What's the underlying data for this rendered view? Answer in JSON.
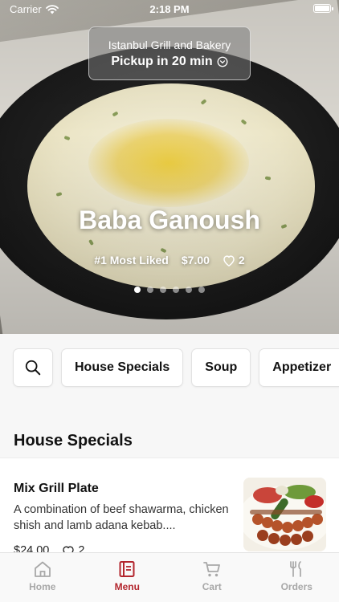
{
  "status_bar": {
    "carrier": "Carrier",
    "time": "2:18 PM"
  },
  "restaurant": {
    "name": "Istanbul Grill and Bakery",
    "pickup": "Pickup in 20 min"
  },
  "featured": {
    "title": "Baba Ganoush",
    "badge": "#1 Most Liked",
    "price": "$7.00",
    "likes": "2",
    "slide_count": 6,
    "active_slide": 1
  },
  "categories": [
    {
      "label": "House Specials"
    },
    {
      "label": "Soup"
    },
    {
      "label": "Appetizer"
    }
  ],
  "section": {
    "title": "House Specials"
  },
  "items": [
    {
      "name": "Mix Grill Plate",
      "description": "A combination of beef shawarma, chicken shish and lamb adana kebab....",
      "price": "$24.00",
      "likes": "2"
    }
  ],
  "tabs": [
    {
      "label": "Home",
      "icon": "home-icon"
    },
    {
      "label": "Menu",
      "icon": "menu-icon",
      "active": true
    },
    {
      "label": "Cart",
      "icon": "cart-icon"
    },
    {
      "label": "Orders",
      "icon": "orders-icon"
    }
  ],
  "colors": {
    "accent": "#b3262e",
    "inactive_tab": "#a8a8a8"
  }
}
